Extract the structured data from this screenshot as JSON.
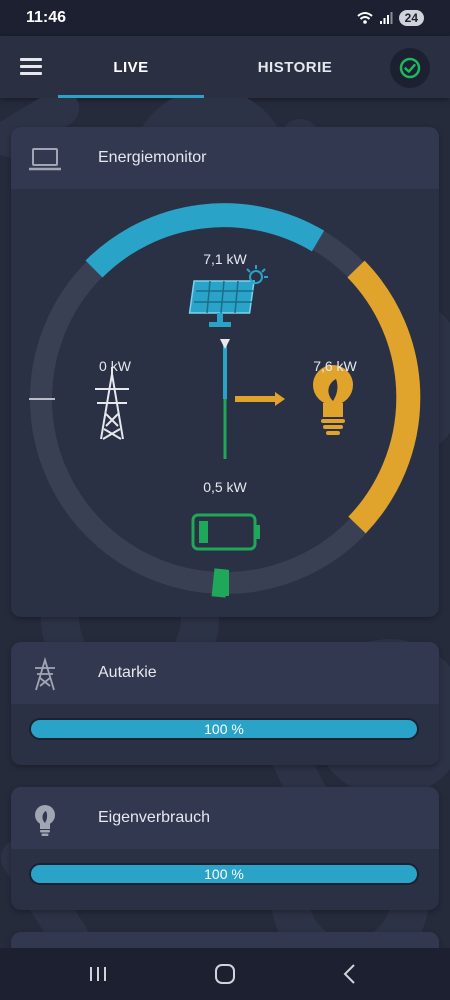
{
  "status_bar": {
    "time": "11:46",
    "battery": "24"
  },
  "app_bar": {
    "tabs": [
      {
        "label": "LIVE",
        "active": true
      },
      {
        "label": "HISTORIE",
        "active": false
      }
    ],
    "connection_status_icon": "check-circle-icon"
  },
  "energy_monitor": {
    "title": "Energiemonitor",
    "solar": {
      "value": "7,1 kW"
    },
    "grid": {
      "value": "0 kW"
    },
    "consumption": {
      "value": "7,6 kW"
    },
    "battery": {
      "value": "0,5 kW"
    }
  },
  "autarkie": {
    "title": "Autarkie",
    "value": "100 %",
    "fraction": 1.0
  },
  "eigenverbrauch": {
    "title": "Eigenverbrauch",
    "value": "100 %",
    "fraction": 1.0
  },
  "colors": {
    "accent": "#2aa3c8",
    "solar": "#2aa3c8",
    "consumption": "#e0a42c",
    "battery": "#1fa85a",
    "background": "#262b3c",
    "card": "#2b3144"
  }
}
